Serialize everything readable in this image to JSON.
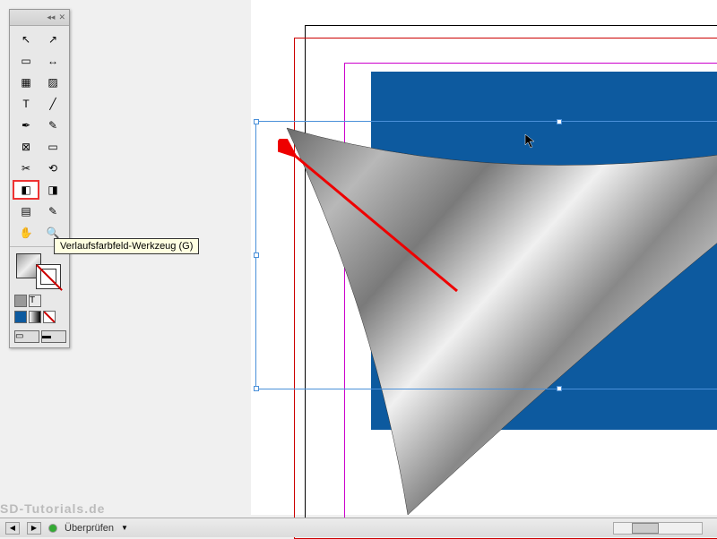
{
  "toolbox": {
    "collapse": "◂◂",
    "close": "✕",
    "tools": [
      {
        "name": "selection-tool",
        "glyph": "↖"
      },
      {
        "name": "direct-selection-tool",
        "glyph": "↗"
      },
      {
        "name": "page-tool",
        "glyph": "▭"
      },
      {
        "name": "gap-tool",
        "glyph": "↔"
      },
      {
        "name": "content-collector",
        "glyph": "▦"
      },
      {
        "name": "content-placer",
        "glyph": "▨"
      },
      {
        "name": "type-tool",
        "glyph": "T"
      },
      {
        "name": "line-tool",
        "glyph": "╱"
      },
      {
        "name": "pen-tool",
        "glyph": "✒"
      },
      {
        "name": "pencil-tool",
        "glyph": "✎"
      },
      {
        "name": "rectangle-frame",
        "glyph": "⊠"
      },
      {
        "name": "rectangle-tool",
        "glyph": "▭"
      },
      {
        "name": "scissors-tool",
        "glyph": "✂"
      },
      {
        "name": "free-transform",
        "glyph": "⟲"
      },
      {
        "name": "gradient-swatch-tool",
        "glyph": "◧"
      },
      {
        "name": "gradient-feather-tool",
        "glyph": "◨"
      },
      {
        "name": "note-tool",
        "glyph": "▤"
      },
      {
        "name": "eyedropper-tool",
        "glyph": "✎"
      },
      {
        "name": "hand-tool",
        "glyph": "✋"
      },
      {
        "name": "zoom-tool",
        "glyph": "🔍"
      }
    ],
    "tooltip": "Verlaufsfarbfeld-Werkzeug (G)",
    "swatches": [
      {
        "name": "color-apply",
        "color": "#0d5a9f"
      },
      {
        "name": "gradient-apply",
        "color": "linear"
      },
      {
        "name": "none-apply",
        "color": "none"
      }
    ]
  },
  "statusbar": {
    "check_label": "Überprüfen",
    "nav_prev": "◀",
    "nav_next": "▶",
    "errors_icon": "●"
  },
  "watermark": "SD-Tutorials.de",
  "colors": {
    "accent": "#0d5a9f",
    "highlight": "#e33",
    "arrow": "#e00"
  }
}
